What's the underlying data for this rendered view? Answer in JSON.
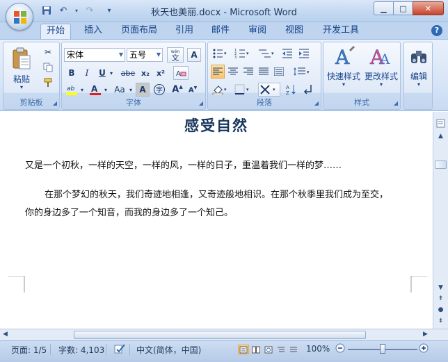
{
  "window": {
    "title": "秋天也美丽.docx - Microsoft Word",
    "minimize_glyph": "▁",
    "maximize_glyph": "□",
    "close_glyph": "✕"
  },
  "qat": {
    "icons": [
      "save-icon",
      "undo-icon",
      "redo-icon",
      "customize-qat-icon"
    ],
    "undo_glyph": "↶",
    "redo_glyph": "↷",
    "more_glyph": "▾"
  },
  "tabs": [
    "开始",
    "插入",
    "页面布局",
    "引用",
    "邮件",
    "审阅",
    "视图",
    "开发工具"
  ],
  "active_tab": "开始",
  "help_label": "?",
  "ribbon": {
    "clipboard": {
      "group_label": "剪贴板",
      "paste_label": "粘贴"
    },
    "font": {
      "group_label": "字体",
      "font_name": "宋体",
      "font_size": "五号",
      "wen_label": "wén\n文",
      "bold": "B",
      "italic": "I",
      "underline": "U",
      "strike": "abe",
      "subscript": "x₂",
      "superscript": "x²",
      "highlight": "ab",
      "font_color": "A",
      "change_case": "Aa",
      "char_shading": "A",
      "enclose": "字",
      "grow": "A",
      "shrink": "A"
    },
    "paragraph": {
      "group_label": "段落"
    },
    "styles": {
      "group_label": "样式",
      "quick_styles": "快速样式",
      "change_styles": "更改样式"
    },
    "editing": {
      "label": "编辑"
    },
    "colors": {
      "highlight": "#ffff00",
      "font_color": "#e02020",
      "accent_blue": "#15428b",
      "pressed": "#fcd88a"
    }
  },
  "document": {
    "title": "感受自然",
    "paragraphs": [
      "又是一个初秋，一样的天空，一样的风，一样的日子，重温着我们一样的梦……",
      "在那个梦幻的秋天，我们奇迹地相逢，又奇迹般地相识。在那个秋季里我们成为至交，",
      "你的身边多了一个知音，而我的身边多了一个知己。"
    ]
  },
  "statusbar": {
    "page": "页面: 1/5",
    "words": "字数: 4,103",
    "language": "中文(简体，中国)",
    "zoom": "100%",
    "zoom_level": 1.0
  }
}
